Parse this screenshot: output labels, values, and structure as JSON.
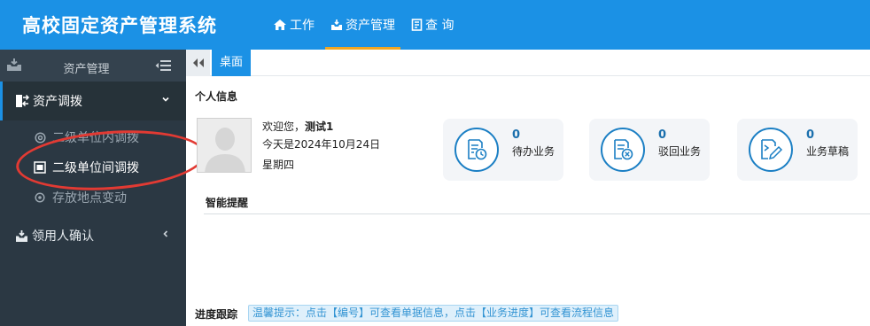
{
  "header": {
    "app_title": "高校固定资产管理系统",
    "nav": [
      {
        "label": "工作",
        "icon": "home-icon"
      },
      {
        "label": "资产管理",
        "icon": "inbox-icon",
        "active": true
      },
      {
        "label": "查 询",
        "icon": "document-icon"
      }
    ]
  },
  "sidebar": {
    "title": "资产管理",
    "groups": [
      {
        "label": "资产调拨",
        "icon": "transfer-icon",
        "expanded": true,
        "items": [
          {
            "label": "二级单位内调拨",
            "icon": "at-icon"
          },
          {
            "label": "二级单位间调拨",
            "icon": "window-icon",
            "active": true
          },
          {
            "label": "存放地点变动",
            "icon": "circle-dot-icon"
          }
        ]
      },
      {
        "label": "领用人确认",
        "icon": "inbox-icon",
        "expanded": false
      }
    ]
  },
  "tabs": [
    {
      "label": "桌面",
      "active": true
    }
  ],
  "profile": {
    "section_title": "个人信息",
    "greeting": "欢迎您，",
    "username": "测试1",
    "date_line": "今天是2024年10月24日",
    "weekday": "星期四"
  },
  "stats": [
    {
      "count": "0",
      "label": "待办业务",
      "icon": "pending-doc-icon"
    },
    {
      "count": "0",
      "label": "驳回业务",
      "icon": "rejected-doc-icon"
    },
    {
      "count": "0",
      "label": "业务草稿",
      "icon": "draft-icon"
    }
  ],
  "reminders": {
    "title": "智能提醒"
  },
  "progress": {
    "title": "进度跟踪",
    "tip": "温馨提示：点击【编号】可查看单据信息，点击【业务进度】可查看流程信息"
  },
  "colors": {
    "primary": "#1b91e5",
    "sidebar_bg": "#2b3843",
    "nav_underline": "#f0a623",
    "annotation": "#e23a33"
  }
}
